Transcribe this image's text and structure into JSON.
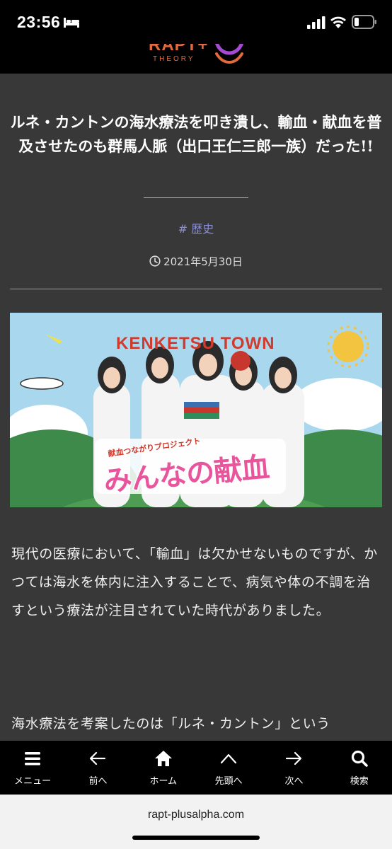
{
  "status_bar": {
    "time": "23:56",
    "icons": [
      "bed-icon",
      "signal-icon",
      "wifi-icon",
      "battery-icon"
    ]
  },
  "header": {
    "logo_text": "RAPT+",
    "logo_subtext": "THEORY"
  },
  "article": {
    "title": "ルネ・カントンの海水療法を叩き潰し、輸血・献血を普及させたのも群馬人脈（出口王仁三郎一族）だった!!",
    "tag": "# 歴史",
    "date": "2021年5月30日",
    "hero": {
      "banner_title": "KENKETSU TOWN",
      "banner_subtitle": "献血つながりプロジェクト",
      "banner_main": "みんなの献血"
    },
    "paragraphs": [
      "現代の医療において、「輸血」は欠かせないものですが、かつては海水を体内に注入することで、病気や体の不調を治すという療法が注目されていた時代がありました。",
      "海水療法を考案したのは「ルネ・カントン」という"
    ]
  },
  "bottom_nav": {
    "items": [
      {
        "label": "メニュー",
        "icon": "menu-icon"
      },
      {
        "label": "前へ",
        "icon": "arrow-left-icon"
      },
      {
        "label": "ホーム",
        "icon": "home-icon"
      },
      {
        "label": "先頭へ",
        "icon": "chevron-up-icon"
      },
      {
        "label": "次へ",
        "icon": "arrow-right-icon"
      },
      {
        "label": "検索",
        "icon": "search-icon"
      }
    ]
  },
  "browser": {
    "url": "rapt-plusalpha.com"
  },
  "colors": {
    "article_bg": "#383838",
    "tag": "#8a8fd6",
    "logo": "#e36a3f",
    "nav_bg": "#000000"
  }
}
